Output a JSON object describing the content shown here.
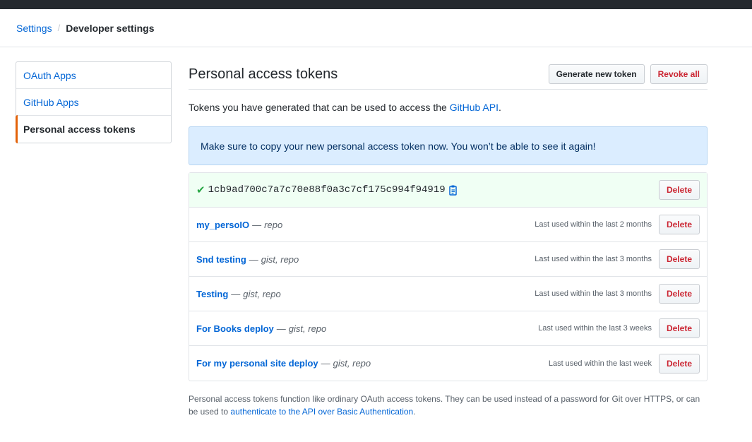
{
  "breadcrumb": {
    "settings": "Settings",
    "separator": "/",
    "current": "Developer settings"
  },
  "sidebar": {
    "items": [
      {
        "label": "OAuth Apps"
      },
      {
        "label": "GitHub Apps"
      },
      {
        "label": "Personal access tokens"
      }
    ]
  },
  "main": {
    "title": "Personal access tokens",
    "generate_button": "Generate new token",
    "revoke_button": "Revoke all",
    "desc_prefix": "Tokens you have generated that can be used to access the ",
    "desc_link": "GitHub API",
    "desc_suffix": ".",
    "flash": "Make sure to copy your new personal access token now. You won’t be able to see it again!",
    "new_token": {
      "value": "1cb9ad700c7a7c70e88f0a3c7cf175c994f94919",
      "delete_label": "Delete"
    },
    "tokens": [
      {
        "name": "my_persoIO",
        "dash": "—",
        "scopes": "repo",
        "last_used": "Last used within the last 2 months",
        "delete_label": "Delete"
      },
      {
        "name": "Snd testing",
        "dash": "—",
        "scopes": "gist, repo",
        "last_used": "Last used within the last 3 months",
        "delete_label": "Delete"
      },
      {
        "name": "Testing",
        "dash": "—",
        "scopes": "gist, repo",
        "last_used": "Last used within the last 3 months",
        "delete_label": "Delete"
      },
      {
        "name": "For Books deploy",
        "dash": "—",
        "scopes": "gist, repo",
        "last_used": "Last used within the last 3 weeks",
        "delete_label": "Delete"
      },
      {
        "name": "For my personal site deploy",
        "dash": "—",
        "scopes": "gist, repo",
        "last_used": "Last used within the last week",
        "delete_label": "Delete"
      }
    ],
    "footnote_prefix": "Personal access tokens function like ordinary OAuth access tokens. They can be used instead of a password for Git over HTTPS, or can be used to ",
    "footnote_link": "authenticate to the API over Basic Authentication",
    "footnote_suffix": "."
  },
  "icons": {
    "check": "check-icon",
    "clipboard": "clipboard-icon"
  },
  "colors": {
    "link": "#0366d6",
    "danger": "#cb2431",
    "selected_accent": "#e36209",
    "flash_bg": "#dbedff",
    "new_token_bg": "#f0fff4",
    "success": "#28a745"
  }
}
